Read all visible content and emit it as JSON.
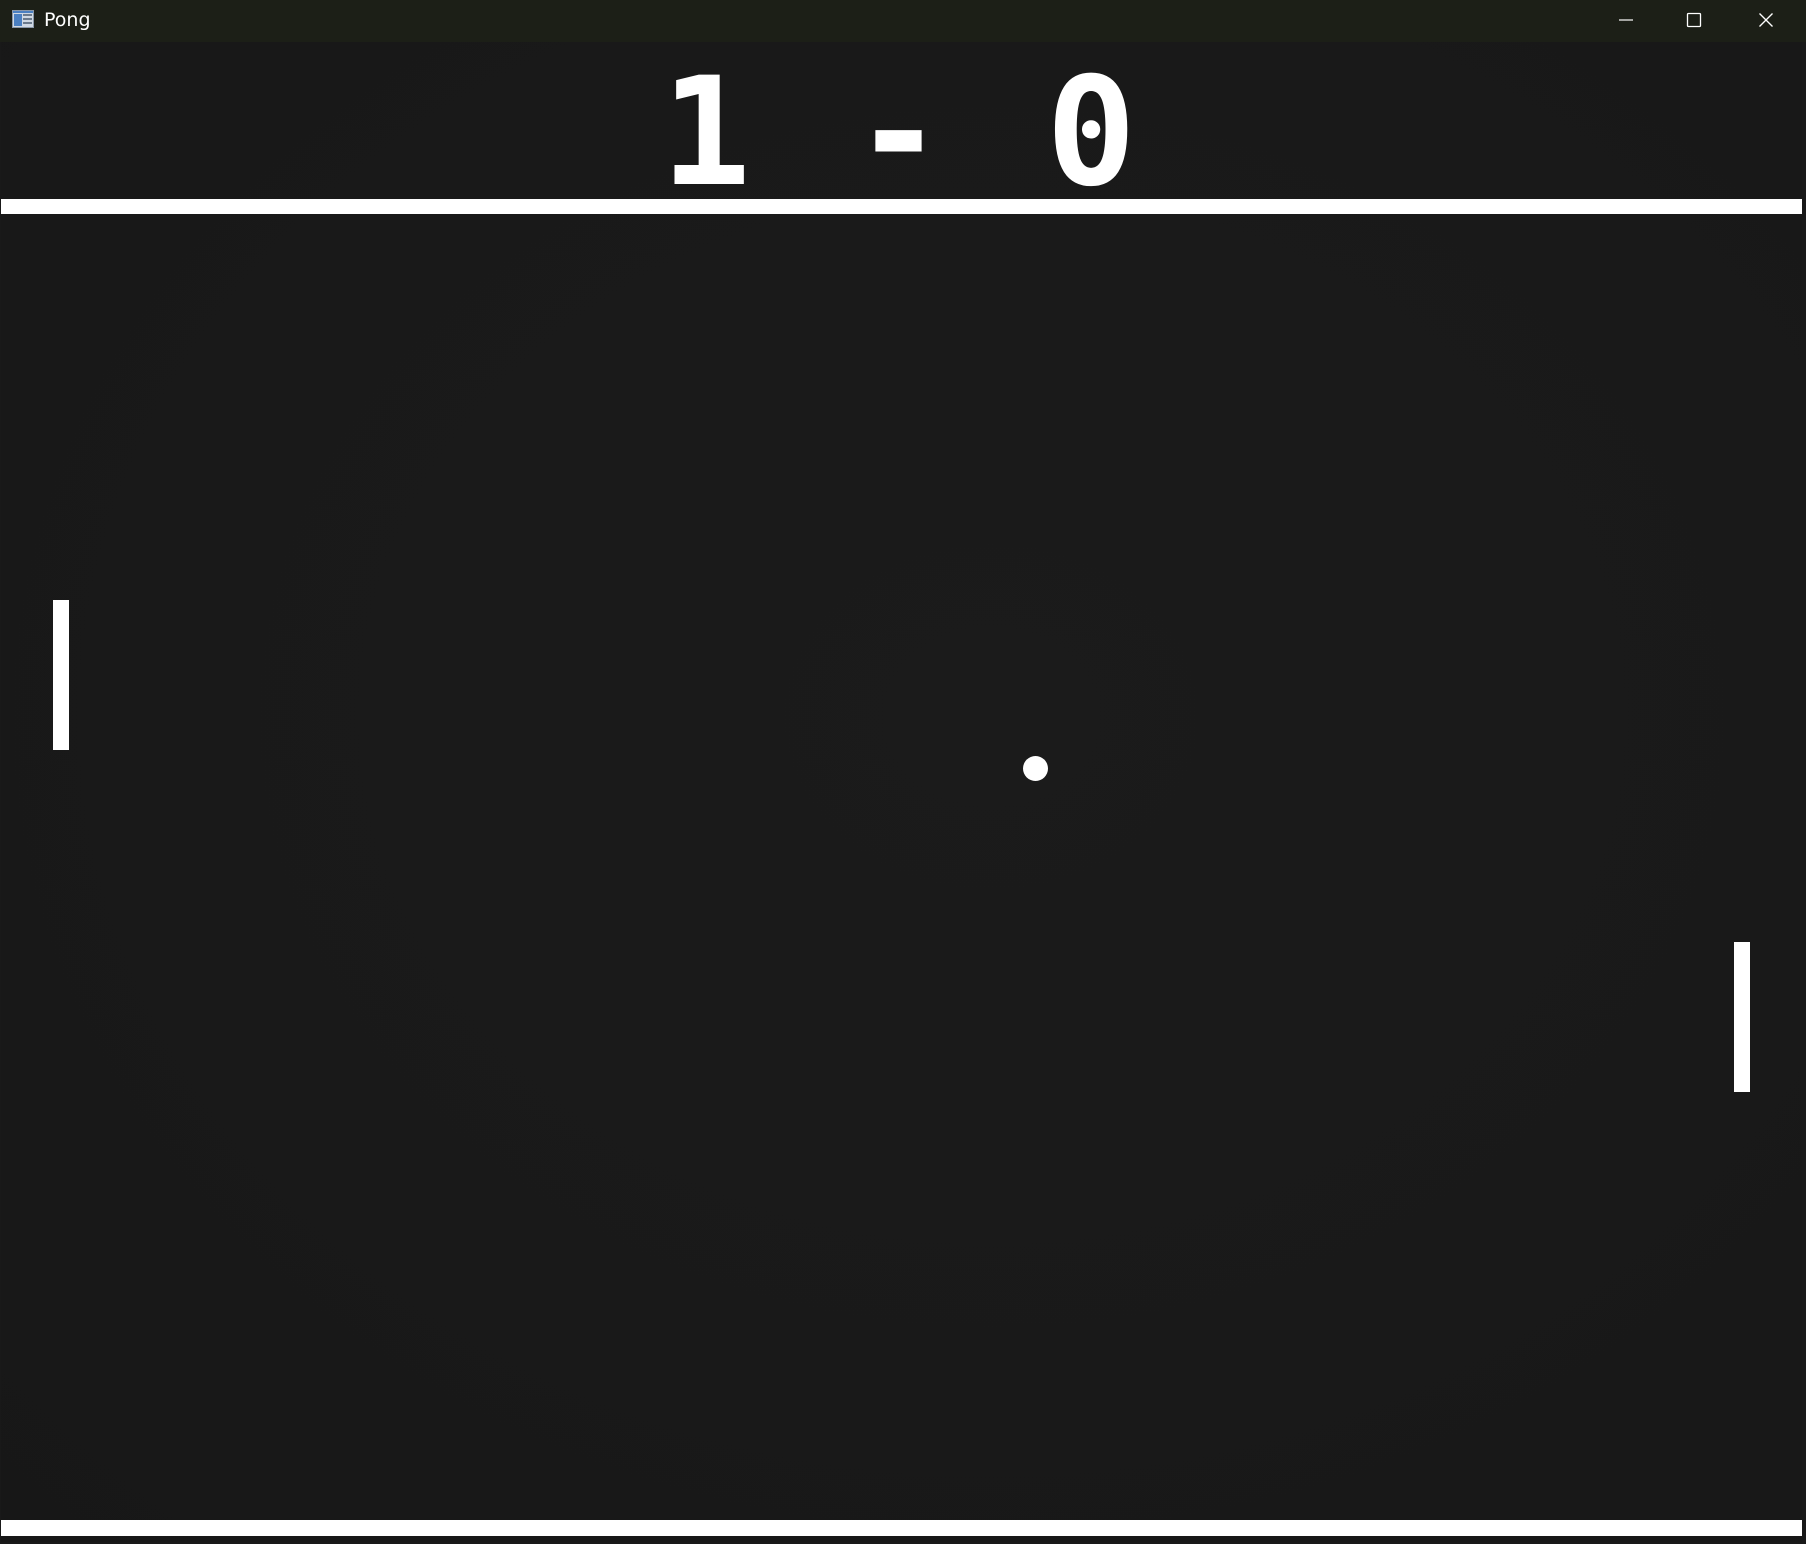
{
  "window": {
    "title": "Pong",
    "icon": "app-window-icon",
    "controls": [
      "minimize-icon",
      "maximize-icon",
      "close-icon"
    ]
  },
  "game": {
    "score_display": "1 - 0",
    "score_left": 1,
    "score_right": 0,
    "colors": {
      "background": "#191919",
      "foreground": "#ffffff",
      "titlebar": "#1c1f17"
    }
  }
}
